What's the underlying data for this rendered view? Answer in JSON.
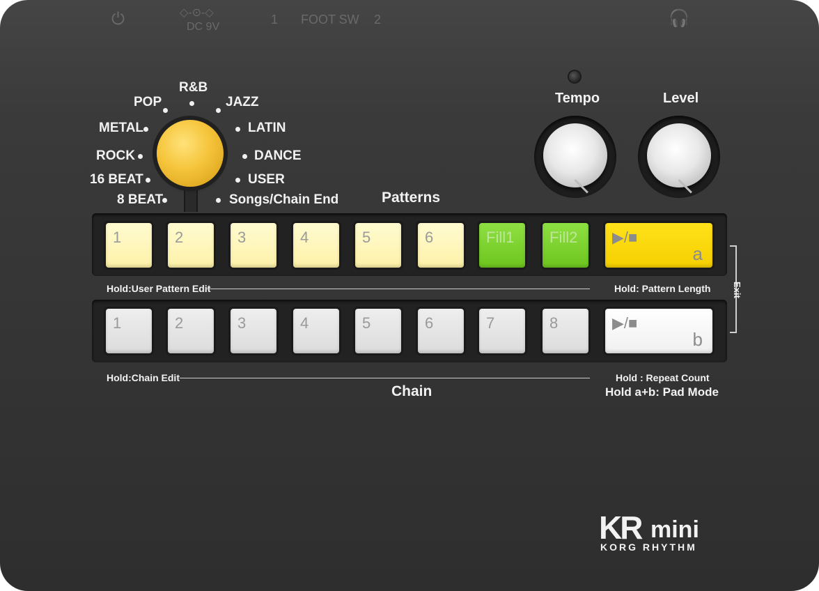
{
  "top_bar": {
    "power_label": "⏻",
    "dc_symbol": "◇-⊙-◇",
    "dc_label": "DC 9V",
    "foot_sw_1": "1",
    "foot_sw_label": "FOOT SW",
    "foot_sw_2": "2",
    "headphone_label": "🎧"
  },
  "genres": [
    "8 BEAT",
    "16 BEAT",
    "ROCK",
    "METAL",
    "POP",
    "R&B",
    "JAZZ",
    "LATIN",
    "DANCE",
    "USER",
    "Songs/Chain End"
  ],
  "knobs": {
    "tempo_label": "Tempo",
    "level_label": "Level"
  },
  "patterns": {
    "title": "Patterns",
    "pads": [
      "1",
      "2",
      "3",
      "4",
      "5",
      "6",
      "Fill1",
      "Fill2"
    ],
    "play_symbol": "▶/■",
    "play_sub": "a",
    "hold_left": "Hold:User Pattern Edit",
    "hold_right": "Hold: Pattern Length"
  },
  "chain": {
    "title": "Chain",
    "pads": [
      "1",
      "2",
      "3",
      "4",
      "5",
      "6",
      "7",
      "8"
    ],
    "play_symbol": "▶/■",
    "play_sub": "b",
    "hold_left": "Hold:Chain Edit",
    "hold_right": "Hold : Repeat Count",
    "pad_mode": "Hold a+b: Pad Mode"
  },
  "exit_label": "Exit",
  "logo": {
    "main": "KR",
    "mini": "mini",
    "sub": "KORG RHYTHM"
  },
  "colors": {
    "pattern_pad": "#fdf1a8",
    "fill_pad": "#7ed332",
    "play_a": "#f8d40a",
    "chain_pad": "#e4e4e4",
    "play_b": "#f8f8f8",
    "selector_knob": "#f5c43a"
  }
}
